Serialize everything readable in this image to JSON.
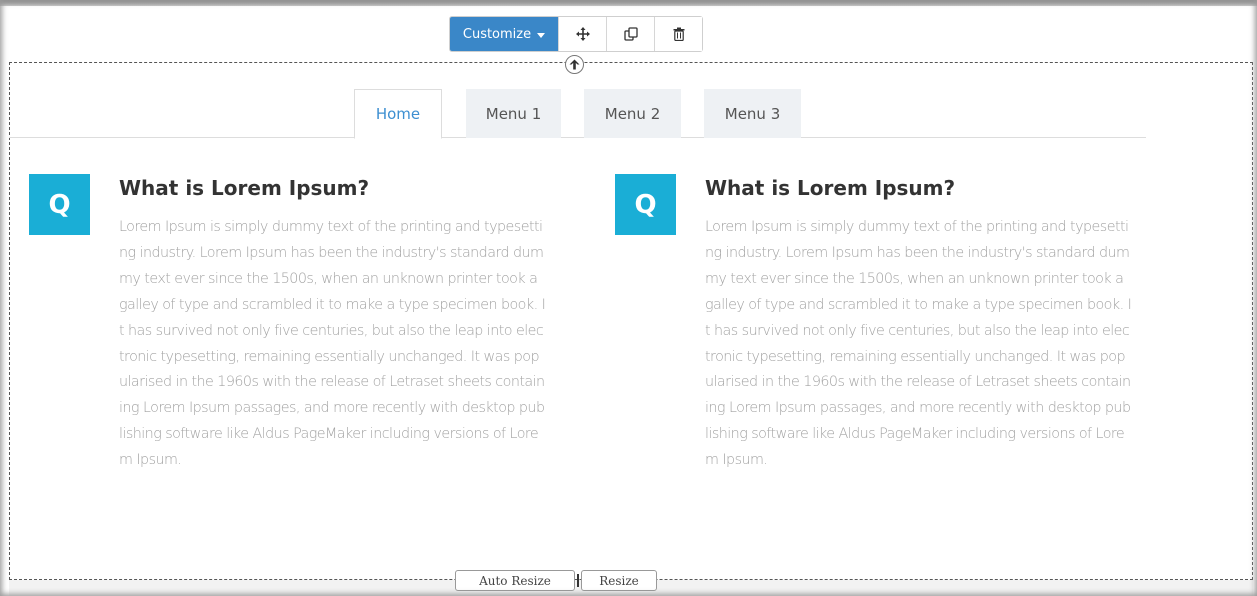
{
  "toolbar": {
    "customize_label": "Customize",
    "move_icon": "move-icon",
    "copy_icon": "copy-icon",
    "delete_icon": "trash-icon",
    "accent_color": "#3a87c8"
  },
  "tabs": [
    {
      "label": "Home",
      "active": true
    },
    {
      "label": "Menu 1",
      "active": false
    },
    {
      "label": "Menu 2",
      "active": false
    },
    {
      "label": "Menu 3",
      "active": false
    }
  ],
  "columns": [
    {
      "badge": "Q",
      "title": "What is Lorem Ipsum?",
      "body": "Lorem Ipsum is simply dummy text of the printing and typesetting industry. Lorem Ipsum has been the industry's standard dummy text ever since the 1500s, when an unknown printer took a galley of type and scrambled it to make a type specimen book. It has survived not only five centuries, but also the leap into electronic typesetting, remaining essentially unchanged. It was popularised in the 1960s with the release of Letraset sheets containing Lorem Ipsum passages, and more recently with desktop publishing software like Aldus PageMaker including versions of Lorem Ipsum."
    },
    {
      "badge": "Q",
      "title": "What is Lorem Ipsum?",
      "body": "Lorem Ipsum is simply dummy text of the printing and typesetting industry. Lorem Ipsum has been the industry's standard dummy text ever since the 1500s, when an unknown printer took a galley of type and scrambled it to make a type specimen book. It has survived not only five centuries, but also the leap into electronic typesetting, remaining essentially unchanged. It was popularised in the 1960s with the release of Letraset sheets containing Lorem Ipsum passages, and more recently with desktop publishing software like Aldus PageMaker including versions of Lorem Ipsum."
    }
  ],
  "resize": {
    "auto_label": "Auto Resize",
    "resize_label": "Resize"
  },
  "colors": {
    "badge": "#1aaed6",
    "active_tab_text": "#3d8fd1",
    "body_text": "#a3a3a3"
  }
}
